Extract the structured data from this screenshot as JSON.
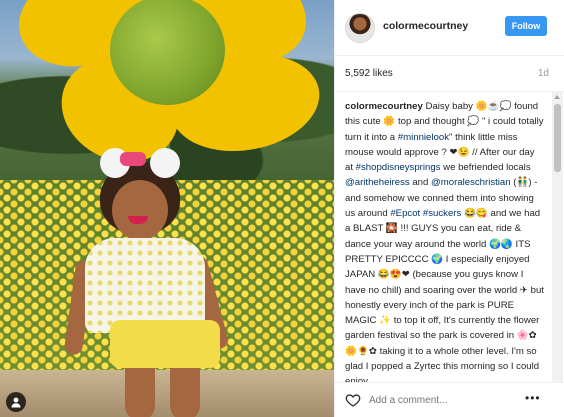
{
  "post": {
    "username": "colormecourtney",
    "follow_label": "Follow",
    "likes": "5,592 likes",
    "time_ago": "1d",
    "caption": {
      "username": "colormecourtney",
      "seg1": " Daisy baby 🌼☕💭 found this cute 🌼 top and thought 💭 \" i could totally turn it into a ",
      "tag1": "#minnielook",
      "seg2": "\" think little miss mouse would approve ? ❤😉 // After our day at ",
      "tag2": "#shopdisneysprings",
      "seg3": " we befriended locals ",
      "tag3": "@aritheheiress",
      "seg4": " and ",
      "tag4": "@moraleschristian",
      "seg5": " (👬) - and somehow we conned them into showing us around ",
      "tag5": "#Epcot",
      "seg6": " ",
      "tag6": "#suckers",
      "seg7": " 😂😋 and we had a BLAST 🎇 !!! GUYS you can eat, ride & dance your way around the world 🌍🌏 ITS PRETTY EPICCCC 🌍 I especially enjoyed JAPAN 😂😍❤ (because you guys know I have no chill) and soaring over the world ✈ but honestly every inch of the park is PURE MAGIC ✨ to top it off, It's currently the flower garden festival so the park is covered in 🌸✿🌼🌻✿ taking it to a whole other level. I'm so glad I popped a Zyrtec this morning so I could enjoy"
    },
    "comment_placeholder": "Add a comment...",
    "more_label": "•••"
  },
  "colors": {
    "follow_button": "#3897f0",
    "hashtag": "#003569",
    "border": "#efefef"
  },
  "icons": [
    "user-tag-icon",
    "heart-icon",
    "more-options-icon"
  ]
}
